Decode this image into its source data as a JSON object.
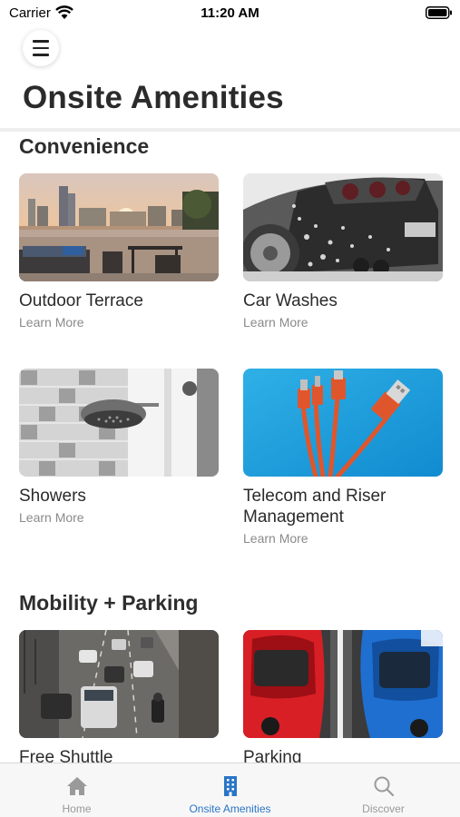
{
  "status_bar": {
    "carrier": "Carrier",
    "time": "11:20 AM"
  },
  "header": {
    "title": "Onsite Amenities"
  },
  "sections": [
    {
      "title": "Convenience",
      "items": [
        {
          "title": "Outdoor Terrace",
          "link": "Learn More",
          "image": "terrace-photo"
        },
        {
          "title": "Car Washes",
          "link": "Learn More",
          "image": "car-wash-photo"
        },
        {
          "title": "Showers",
          "link": "Learn More",
          "image": "shower-photo"
        },
        {
          "title": "Telecom and Riser Management",
          "link": "Learn More",
          "image": "cables-photo"
        }
      ]
    },
    {
      "title": "Mobility + Parking",
      "items": [
        {
          "title": "Free Shuttle",
          "image": "traffic-photo"
        },
        {
          "title": "Parking",
          "image": "parked-cars-photo"
        }
      ]
    }
  ],
  "tab_bar": {
    "tabs": [
      {
        "label": "Home",
        "icon": "home-icon",
        "active": false
      },
      {
        "label": "Onsite Amenities",
        "icon": "building-icon",
        "active": true
      },
      {
        "label": "Discover",
        "icon": "search-icon",
        "active": false
      }
    ],
    "active_color": "#2a75c7",
    "inactive_color": "#999999"
  }
}
